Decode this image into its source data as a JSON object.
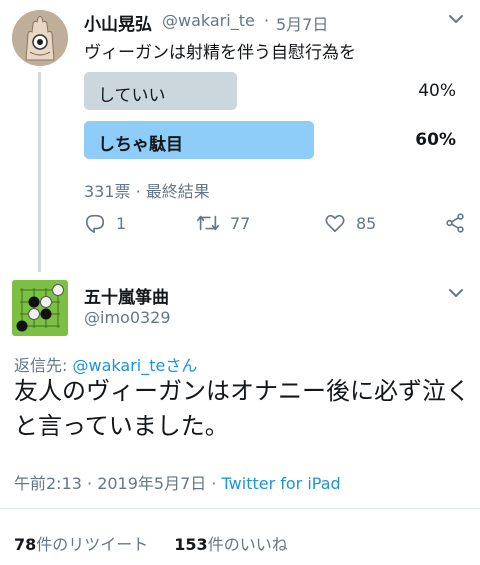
{
  "tweet": {
    "name": "小山晃弘",
    "handle": "@wakari_te",
    "separator": "·",
    "date": "5月7日",
    "text": "ヴィーガンは射精を伴う自慰行為を"
  },
  "poll": {
    "options": [
      {
        "label": "していい",
        "percent_text": "40%",
        "percent": 40,
        "winner": false
      },
      {
        "label": "しちゃ駄目",
        "percent_text": "60%",
        "percent": 60,
        "winner": true
      }
    ],
    "meta": "331票 · 最終結果"
  },
  "actions": {
    "reply_count": "1",
    "retweet_count": "77",
    "like_count": "85"
  },
  "reply": {
    "name": "五十嵐箏曲",
    "handle": "@imo0329",
    "replying_prefix": "返信先: ",
    "replying_to": "@wakari_te",
    "replying_suffix": "さん",
    "text": "友人のヴィーガンはオナニー後に必ず泣くと言っていました。",
    "time": "午前2:13 · 2019年5月7日 · ",
    "client": "Twitter for iPad",
    "retweets_count": "78",
    "retweets_label": "件のリツイート",
    "likes_count": "153",
    "likes_label": "件のいいね"
  },
  "colors": {
    "accent": "#1b95e0",
    "poll_winner": "#8ecdf8",
    "poll_loser": "#ccd6dd",
    "secondary_text": "#657786"
  },
  "icons": [
    "chevron-down-icon",
    "reply-icon",
    "retweet-icon",
    "like-icon",
    "share-icon"
  ]
}
